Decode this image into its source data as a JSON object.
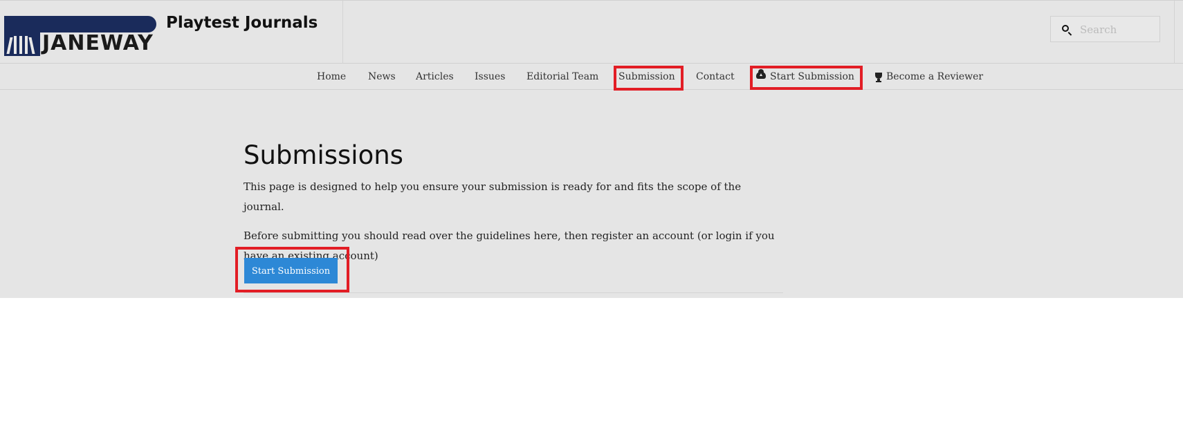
{
  "site": {
    "logo_text": "JANEWAY",
    "title": "Playtest Journals"
  },
  "search": {
    "placeholder": "Search",
    "icon": "search-icon"
  },
  "nav": {
    "items": [
      {
        "label": "Home"
      },
      {
        "label": "News"
      },
      {
        "label": "Articles"
      },
      {
        "label": "Issues"
      },
      {
        "label": "Editorial Team"
      },
      {
        "label": "Submission"
      },
      {
        "label": "Contact"
      },
      {
        "label": "Start Submission",
        "icon": "cloud-upload-icon"
      },
      {
        "label": "Become a Reviewer",
        "icon": "trophy-icon"
      }
    ]
  },
  "main": {
    "title": "Submissions",
    "paragraph1": "This page is designed to help you ensure your submission is ready for and fits the scope of the journal.",
    "paragraph2": "Before submitting you should read over the guidelines here, then register an account (or login if you have an existing account)",
    "cta_label": "Start Submission"
  },
  "colors": {
    "page_background": "#e5e5e5",
    "brand_navy": "#1a2b5b",
    "button_blue": "#2d88d6",
    "highlight_red": "#e21d25"
  }
}
